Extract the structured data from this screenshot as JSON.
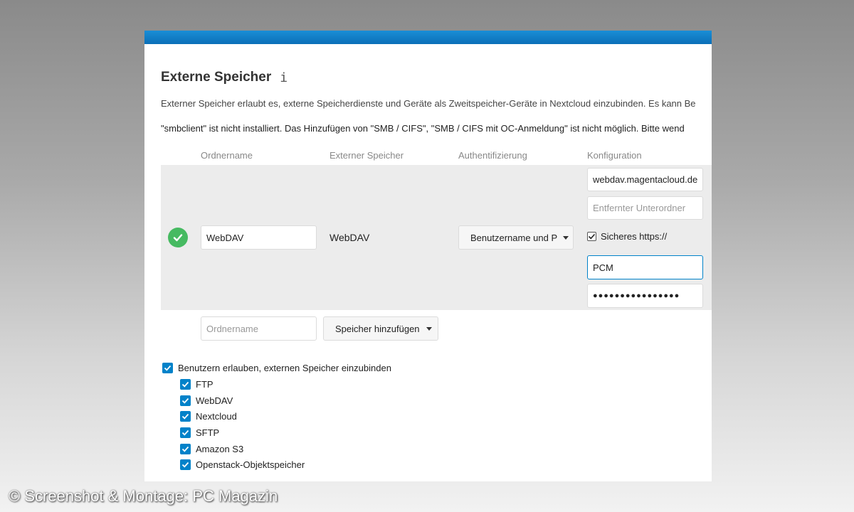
{
  "section": {
    "title": "Externe Speicher",
    "info_icon": "i",
    "description": "Externer Speicher erlaubt es, externe Speicherdienste und Geräte als Zweitspeicher-Geräte in Nextcloud einzubinden. Es kann Be",
    "warning": "\"smbclient\" ist nicht installiert. Das Hinzufügen von \"SMB / CIFS\", \"SMB / CIFS mit OC-Anmeldung\" ist nicht möglich. Bitte wend"
  },
  "table": {
    "headers": [
      "Ordnername",
      "Externer Speicher",
      "Authentifizierung",
      "Konfiguration"
    ],
    "mount": {
      "folder_name": "WebDAV",
      "backend": "WebDAV",
      "auth": "Benutzername und P",
      "config": {
        "host": "webdav.magentacloud.de",
        "subfolder_placeholder": "Entfernter Unterordner",
        "secure_label": "Sicheres https://",
        "user": "PCM",
        "password": "●●●●●●●●●●●●●●●●"
      }
    },
    "new_row": {
      "folder_placeholder": "Ordnername",
      "add_label": "Speicher hinzufügen"
    }
  },
  "allow_users": {
    "label": "Benutzern erlauben, externen Speicher einzubinden",
    "backends": [
      "FTP",
      "WebDAV",
      "Nextcloud",
      "SFTP",
      "Amazon S3",
      "Openstack-Objektspeicher"
    ]
  },
  "watermark": "© Screenshot & Montage: PC Magazin",
  "colors": {
    "accent": "#0082c9",
    "success": "#46ba61",
    "topbar": "#0b6fb8"
  }
}
